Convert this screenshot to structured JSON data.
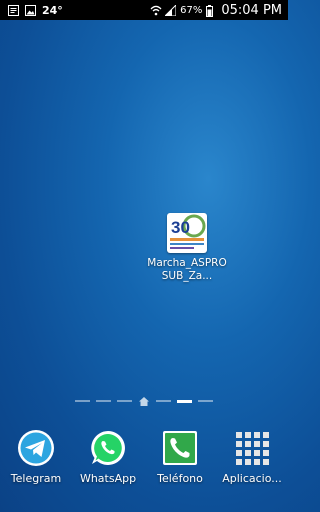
{
  "status_bar": {
    "notification_icon": "notes-icon",
    "image_icon": "image-icon",
    "temperature": "24°",
    "wifi_icon": "wifi-icon",
    "signal_icon": "signal-icon",
    "battery_percent": "67%",
    "battery_icon": "battery-icon",
    "time": "05:04 PM"
  },
  "home_shortcut": {
    "label": "Marcha_ASPROSUB_Za...",
    "thumbnail_text": "30",
    "thumbnail_caption": "MARCHA"
  },
  "page_indicator": {
    "pages": 7,
    "home_index": 3,
    "active_index": 5
  },
  "dock": {
    "apps": [
      {
        "label": "Telegram",
        "icon": "telegram-icon",
        "color": "#2ca5e0"
      },
      {
        "label": "WhatsApp",
        "icon": "whatsapp-icon",
        "color": "#25d366"
      },
      {
        "label": "Teléfono",
        "icon": "phone-icon",
        "color": "#31a84a"
      },
      {
        "label": "Aplicacio...",
        "icon": "apps-grid-icon",
        "color": "#e6e6e6"
      }
    ]
  },
  "colors": {
    "wallpaper": "#1466b0",
    "status_bar_bg": "#000000"
  }
}
